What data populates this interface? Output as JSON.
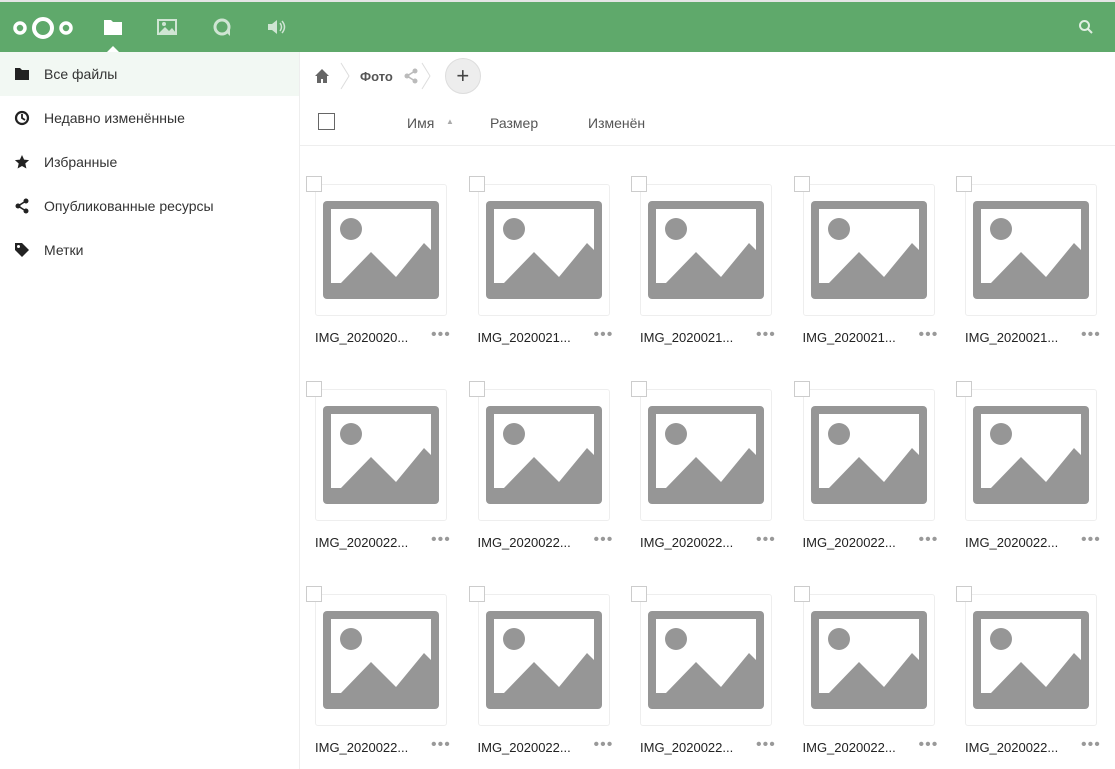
{
  "header": {
    "accent": "#5fa96b",
    "apps": [
      "files-icon",
      "gallery-icon",
      "talk-icon",
      "audio-player-icon"
    ]
  },
  "sidebar": {
    "items": [
      {
        "label": "Все файлы",
        "icon": "folder-icon"
      },
      {
        "label": "Недавно изменённые",
        "icon": "clock-icon"
      },
      {
        "label": "Избранные",
        "icon": "star-icon"
      },
      {
        "label": "Опубликованные ресурсы",
        "icon": "share-icon"
      },
      {
        "label": "Метки",
        "icon": "tag-icon"
      }
    ]
  },
  "breadcrumb": {
    "folder": "Фото",
    "add": "+"
  },
  "columns": {
    "name": "Имя",
    "size": "Размер",
    "modified": "Изменён"
  },
  "files": [
    "IMG_2020020...",
    "IMG_2020021...",
    "IMG_2020021...",
    "IMG_2020021...",
    "IMG_2020021...",
    "IMG_2020022...",
    "IMG_2020022...",
    "IMG_2020022...",
    "IMG_2020022...",
    "IMG_2020022...",
    "IMG_2020022...",
    "IMG_2020022...",
    "IMG_2020022...",
    "IMG_2020022...",
    "IMG_2020022..."
  ],
  "more_label": "•••"
}
